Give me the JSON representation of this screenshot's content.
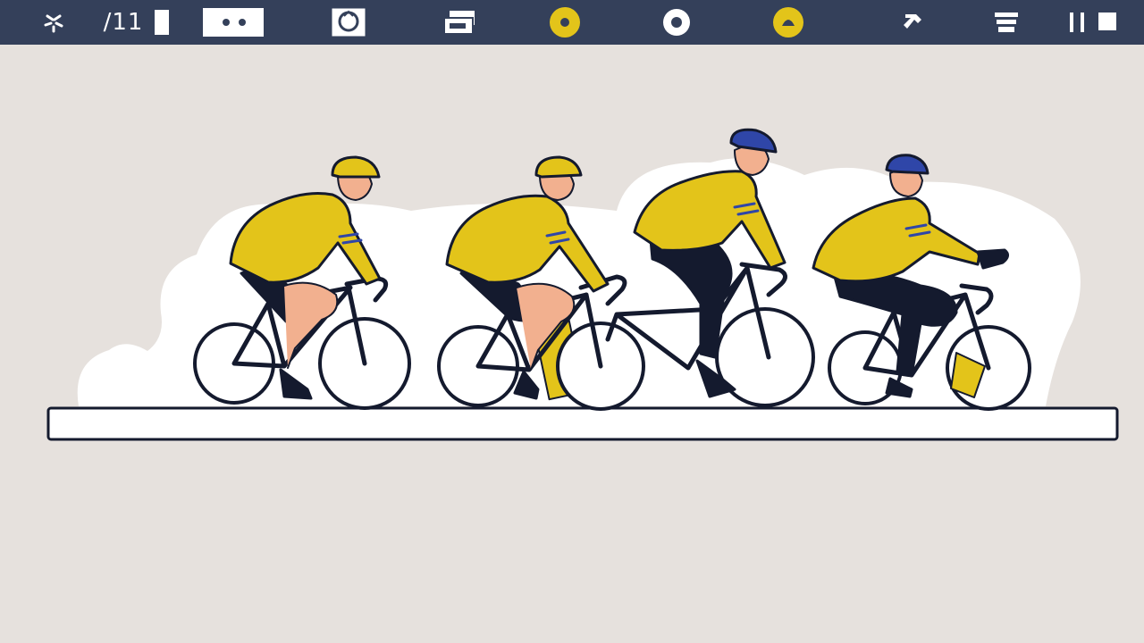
{
  "toolbar": {
    "counter": "/11",
    "icons": [
      "sparkle-icon",
      "slider-box-icon",
      "stamp-icon",
      "layers-icon",
      "yellow-circle-icon",
      "record-icon",
      "yellow-dome-icon",
      "hammer-icon",
      "stack-icon",
      "pause-stop-icon"
    ]
  },
  "colors": {
    "toolbar": "#34405a",
    "background": "#e6e1dd",
    "jersey": "#e3c41a",
    "helmet_blue": "#2f46a8",
    "outline": "#141a2e"
  }
}
